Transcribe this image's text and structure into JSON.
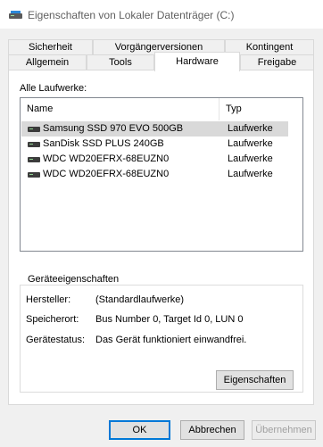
{
  "window": {
    "title": "Eigenschaften von Lokaler Datenträger (C:)",
    "icon": "drive-icon"
  },
  "tabs_top": [
    {
      "label": "Sicherheit"
    },
    {
      "label": "Vorgängerversionen"
    },
    {
      "label": "Kontingent"
    }
  ],
  "tabs_bottom": [
    {
      "label": "Allgemein"
    },
    {
      "label": "Tools"
    },
    {
      "label": "Hardware",
      "active": true
    },
    {
      "label": "Freigabe"
    }
  ],
  "hardware": {
    "all_drives_label": "Alle Laufwerke:",
    "columns": {
      "name": "Name",
      "type": "Typ"
    },
    "drives": [
      {
        "name": "Samsung SSD 970 EVO 500GB",
        "type": "Laufwerke",
        "selected": true
      },
      {
        "name": "SanDisk SSD PLUS 240GB",
        "type": "Laufwerke"
      },
      {
        "name": "WDC WD20EFRX-68EUZN0",
        "type": "Laufwerke"
      },
      {
        "name": "WDC WD20EFRX-68EUZN0",
        "type": "Laufwerke"
      }
    ],
    "device_properties": {
      "title": "Geräteeigenschaften",
      "manufacturer_label": "Hersteller:",
      "manufacturer_value": "(Standardlaufwerke)",
      "location_label": "Speicherort:",
      "location_value": "Bus Number 0, Target Id 0, LUN 0",
      "status_label": "Gerätestatus:",
      "status_value": "Das Gerät funktioniert einwandfrei.",
      "properties_button": "Eigenschaften"
    }
  },
  "footer": {
    "ok": "OK",
    "cancel": "Abbrechen",
    "apply": "Übernehmen"
  },
  "colors": {
    "selection": "#d9d9d9",
    "focus_border": "#0078d7"
  }
}
